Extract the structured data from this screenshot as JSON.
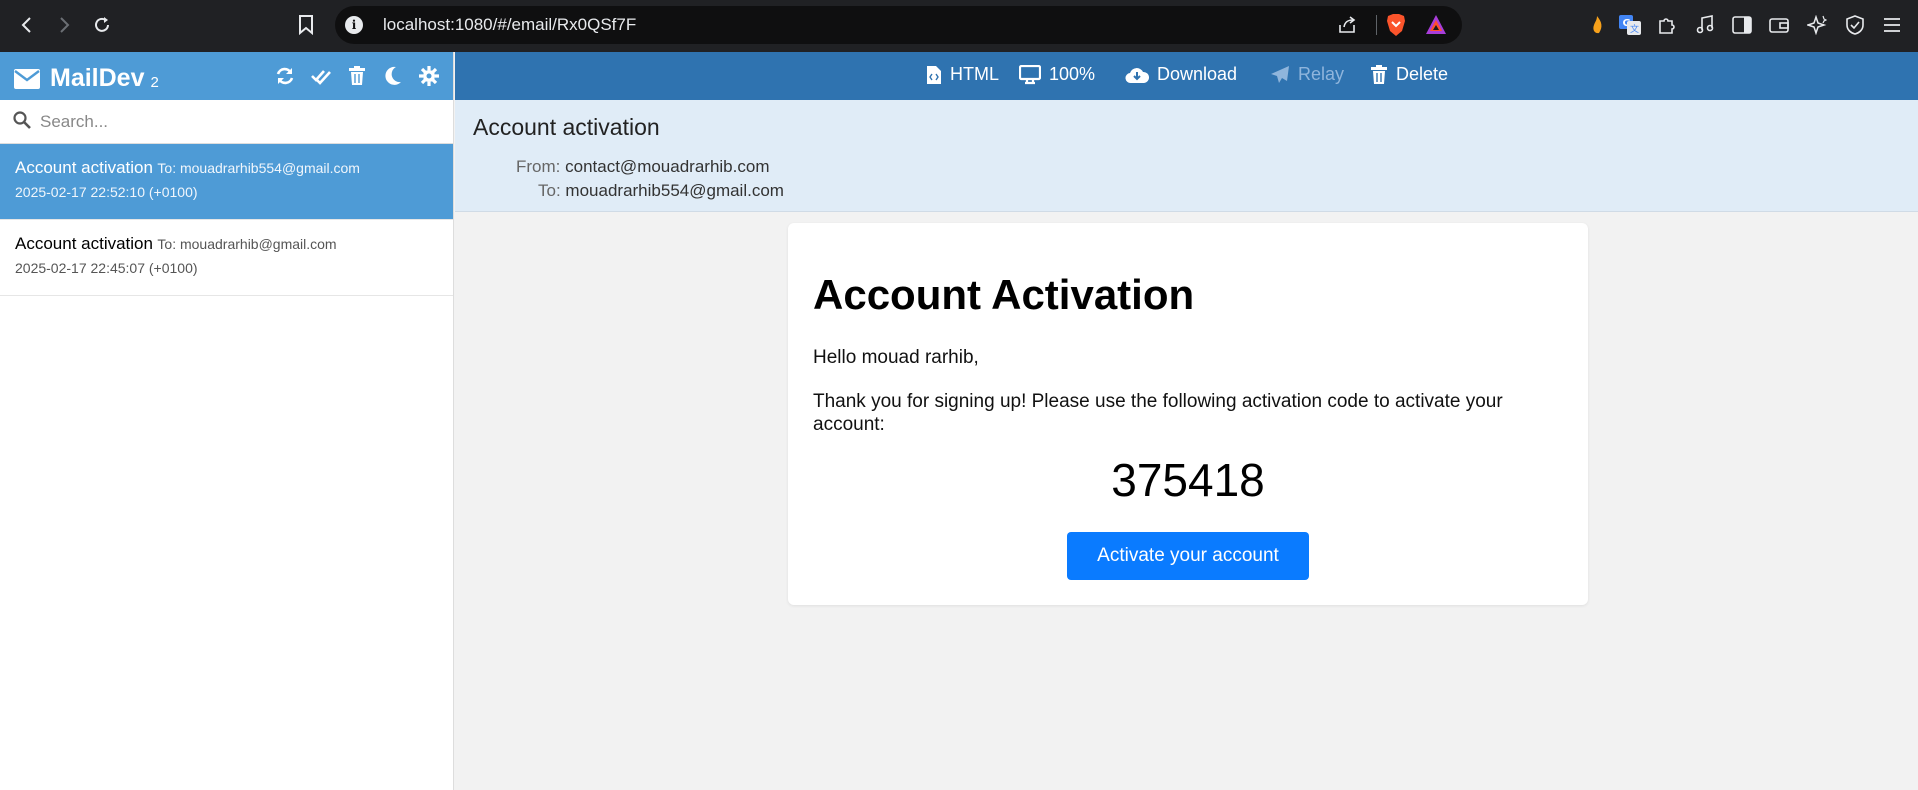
{
  "browser": {
    "url": "localhost:1080/#/email/Rx0QSf7F"
  },
  "app": {
    "name": "MailDev",
    "email_count": "2"
  },
  "search": {
    "placeholder": "Search..."
  },
  "emails": [
    {
      "subject": "Account activation",
      "to": "To: mouadrarhib554@gmail.com",
      "date": "2025-02-17 22:52:10 (+0100)",
      "active": true
    },
    {
      "subject": "Account activation",
      "to": "To: mouadrarhib@gmail.com",
      "date": "2025-02-17 22:45:07 (+0100)",
      "active": false
    }
  ],
  "toolbar": {
    "html_label": "HTML",
    "zoom_label": "100%",
    "download_label": "Download",
    "relay_label": "Relay",
    "delete_label": "Delete"
  },
  "message": {
    "subject": "Account activation",
    "from_key": "From:",
    "from": "contact@mouadrarhib.com",
    "to_key": "To:",
    "to": "mouadrarhib554@gmail.com"
  },
  "body": {
    "heading": "Account Activation",
    "greeting": "Hello mouad rarhib,",
    "text": "Thank you for signing up! Please use the following activation code to activate your account:",
    "code": "375418",
    "button_label": "Activate your account"
  },
  "colors": {
    "header_blue": "#4e9bd6",
    "toolbar_blue": "#2f73b0",
    "button_blue": "#0a7bff"
  }
}
